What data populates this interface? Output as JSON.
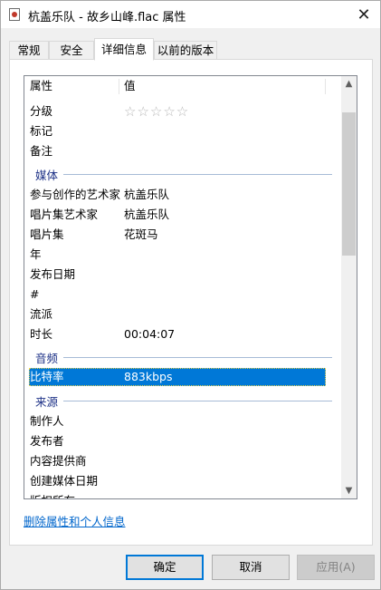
{
  "window": {
    "title": "杭盖乐队 - 故乡山峰.flac 属性",
    "close_glyph": "✕"
  },
  "tabs": [
    {
      "label": "常规"
    },
    {
      "label": "安全"
    },
    {
      "label": "详细信息"
    },
    {
      "label": "以前的版本"
    }
  ],
  "details": {
    "headers": {
      "property": "属性",
      "value": "值"
    },
    "rating": {
      "label": "分级",
      "stars": "☆☆☆☆☆"
    },
    "tags": {
      "label": "标记"
    },
    "comments": {
      "label": "备注"
    },
    "group_media": "媒体",
    "media": [
      {
        "key": "参与创作的艺术家",
        "value": "杭盖乐队"
      },
      {
        "key": "唱片集艺术家",
        "value": "杭盖乐队"
      },
      {
        "key": "唱片集",
        "value": "花斑马"
      },
      {
        "key": "年",
        "value": ""
      },
      {
        "key": "发布日期",
        "value": ""
      },
      {
        "key": "#",
        "value": ""
      },
      {
        "key": "流派",
        "value": ""
      },
      {
        "key": "时长",
        "value": "00:04:07"
      }
    ],
    "group_audio": "音频",
    "audio": [
      {
        "key": "比特率",
        "value": "883kbps"
      }
    ],
    "group_origin": "来源",
    "origin": [
      {
        "key": "制作人",
        "value": ""
      },
      {
        "key": "发布者",
        "value": ""
      },
      {
        "key": "内容提供商",
        "value": ""
      },
      {
        "key": "创建媒体日期",
        "value": ""
      },
      {
        "key": "版权所有",
        "value": ""
      }
    ]
  },
  "scrollbar": {
    "up": "▲",
    "down": "▼"
  },
  "remove_link": "删除属性和个人信息",
  "buttons": {
    "ok": "确定",
    "cancel": "取消",
    "apply": "应用(A)"
  }
}
